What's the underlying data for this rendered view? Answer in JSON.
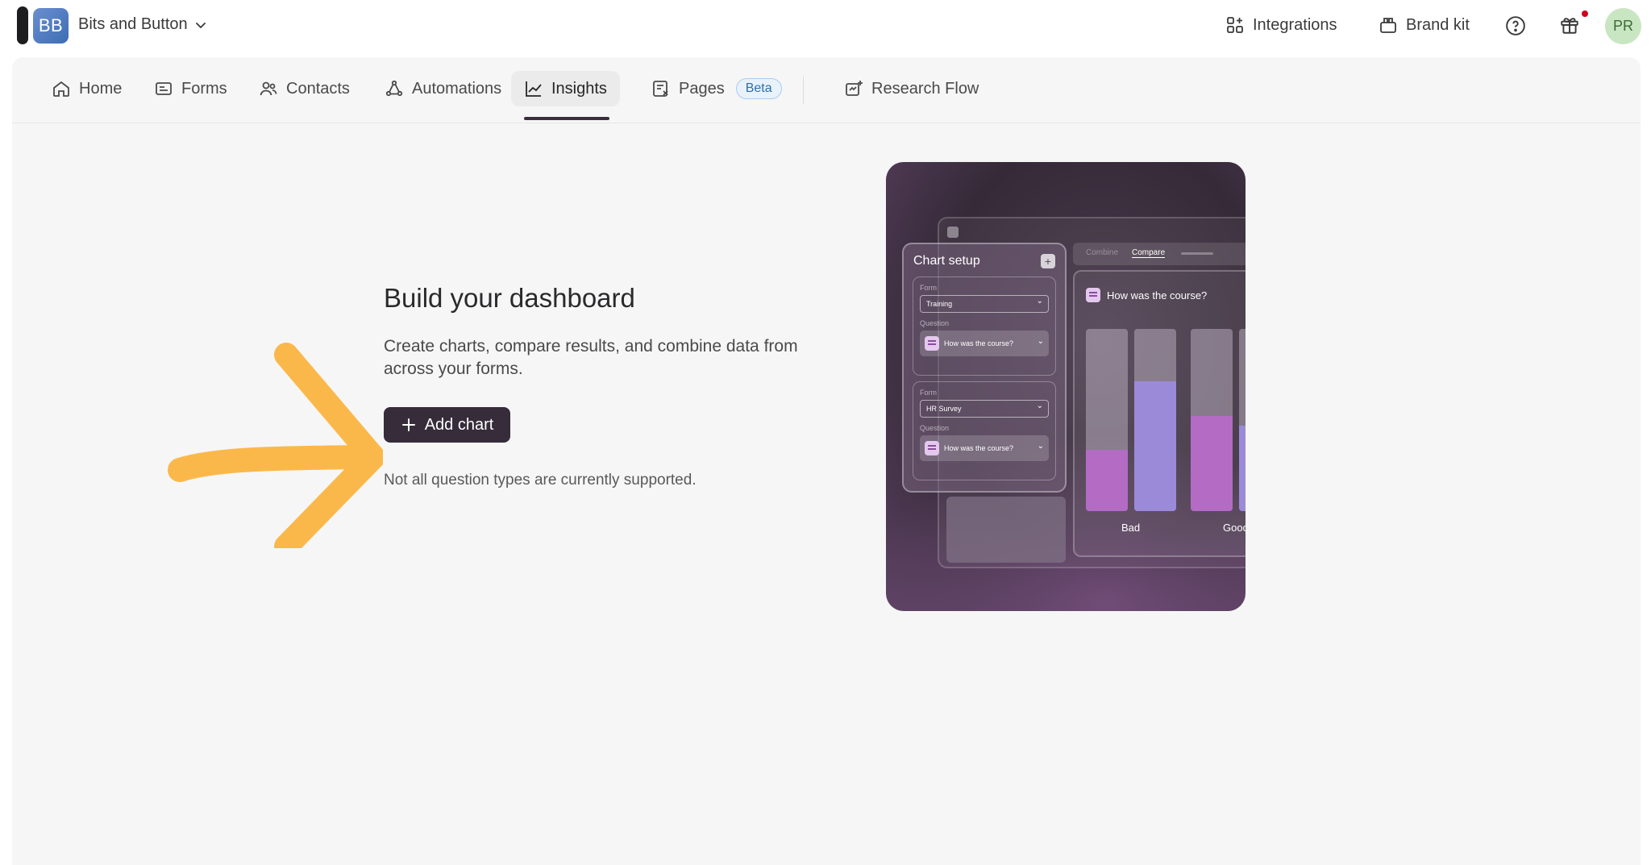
{
  "workspace": {
    "initials": "BB",
    "name": "Bits and Button"
  },
  "topbar": {
    "integrations_label": "Integrations",
    "brand_kit_label": "Brand kit",
    "user_initials": "PR"
  },
  "nav": {
    "items": [
      {
        "label": "Home",
        "icon": "home-icon"
      },
      {
        "label": "Forms",
        "icon": "forms-icon"
      },
      {
        "label": "Contacts",
        "icon": "contacts-icon"
      },
      {
        "label": "Automations",
        "icon": "automations-icon"
      },
      {
        "label": "Insights",
        "icon": "insights-icon",
        "active": true
      },
      {
        "label": "Pages",
        "icon": "pages-icon",
        "badge": "Beta"
      },
      {
        "label": "Research Flow",
        "icon": "research-flow-icon"
      }
    ]
  },
  "empty_state": {
    "title": "Build your dashboard",
    "description": "Create charts, compare results, and combine data from across your forms.",
    "add_button": "Add chart",
    "note": "Not all question types are currently supported."
  },
  "illustration": {
    "setup_title": "Chart setup",
    "card1": {
      "form_label": "Form",
      "form_value": "Training",
      "question_label": "Question",
      "question_value": "How was the course?"
    },
    "card2": {
      "form_label": "Form",
      "form_value": "HR Survey",
      "question_label": "Question",
      "question_value": "How was the course?"
    },
    "tabs": {
      "combine": "Combine",
      "compare": "Compare"
    },
    "chart_question": "How was the course?",
    "bar_labels": [
      "Bad",
      "Good"
    ],
    "accent_colors": {
      "purple": "#b36bc4",
      "lavender": "#9b8ad8"
    }
  },
  "colors": {
    "arrow": "#fbb84a",
    "primary_button": "#362c3a",
    "beta_text": "#2e6fa8"
  }
}
